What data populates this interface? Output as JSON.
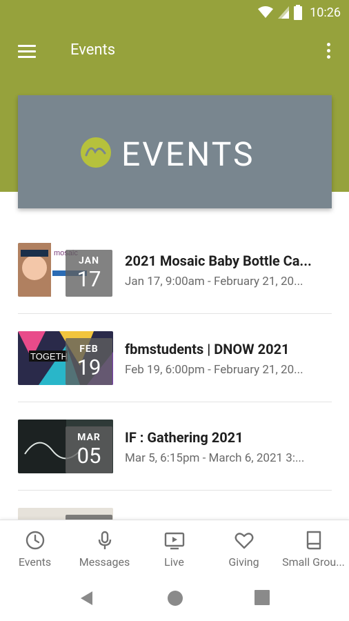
{
  "status_bar": {
    "time": "10:26"
  },
  "app_bar": {
    "title": "Events",
    "menu_icon": "hamburger-menu-icon",
    "more_icon": "more-vertical-icon"
  },
  "hero": {
    "banner_text": "EVENTS",
    "logo_color": "#b6c13c",
    "background_color": "#79868f"
  },
  "events": [
    {
      "title": "2021 Mosaic Baby Bottle Ca...",
      "time": "Jan 17, 9:00am - February 21, 20...",
      "month": "JAN",
      "day": "17"
    },
    {
      "title": "fbmstudents | DNOW 2021",
      "time": "Feb 19, 6:00pm - February 21, 20...",
      "month": "FEB",
      "day": "19"
    },
    {
      "title": "IF : Gathering 2021",
      "time": "Mar 5, 6:15pm - March 6, 2021 3:...",
      "month": "MAR",
      "day": "05"
    }
  ],
  "bottom_nav": [
    {
      "label": "Events",
      "icon": "clock-icon"
    },
    {
      "label": "Messages",
      "icon": "microphone-icon"
    },
    {
      "label": "Live",
      "icon": "play-screen-icon"
    },
    {
      "label": "Giving",
      "icon": "heart-icon"
    },
    {
      "label": "Small Grou...",
      "icon": "book-icon"
    }
  ],
  "colors": {
    "brand": "#96a23c",
    "text_primary": "#1f1f1f",
    "text_secondary": "#6a6a6a"
  }
}
